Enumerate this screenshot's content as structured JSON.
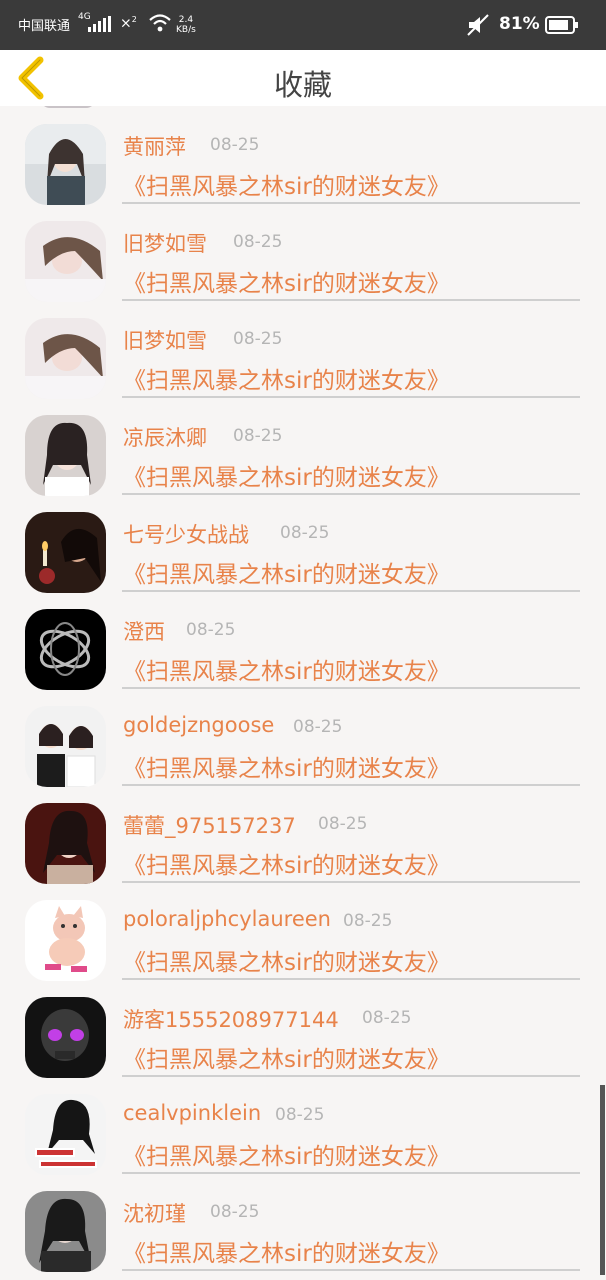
{
  "status_bar": {
    "carrier": "中国联通",
    "network": "4G",
    "sim2": "2",
    "speed_value": "2.4",
    "speed_unit": "KB/s",
    "battery": "81%"
  },
  "header": {
    "title": "收藏"
  },
  "favorites": [
    {
      "name": "黄丽萍",
      "date": "08-25",
      "book": "《扫黑风暴之林sir的财迷女友》"
    },
    {
      "name": "旧梦如雪",
      "date": "08-25",
      "book": "《扫黑风暴之林sir的财迷女友》"
    },
    {
      "name": "旧梦如雪",
      "date": "08-25",
      "book": "《扫黑风暴之林sir的财迷女友》"
    },
    {
      "name": "凉辰沐卿",
      "date": "08-25",
      "book": "《扫黑风暴之林sir的财迷女友》"
    },
    {
      "name": "七号少女战战",
      "date": "08-25",
      "book": "《扫黑风暴之林sir的财迷女友》"
    },
    {
      "name": "澄西",
      "date": "08-25",
      "book": "《扫黑风暴之林sir的财迷女友》"
    },
    {
      "name": "goldejzngoose",
      "date": "08-25",
      "book": "《扫黑风暴之林sir的财迷女友》"
    },
    {
      "name": "蕾蕾_975157237",
      "date": "08-25",
      "book": "《扫黑风暴之林sir的财迷女友》"
    },
    {
      "name": "poloraljphcylaureen",
      "date": "08-25",
      "book": "《扫黑风暴之林sir的财迷女友》"
    },
    {
      "name": "游客1555208977144",
      "date": "08-25",
      "book": "《扫黑风暴之林sir的财迷女友》"
    },
    {
      "name": "cealvpinklein",
      "date": "08-25",
      "book": "《扫黑风暴之林sir的财迷女友》"
    },
    {
      "name": "沈初瑾",
      "date": "08-25",
      "book": "《扫黑风暴之林sir的财迷女友》"
    }
  ],
  "colors": {
    "accent": "#e8834a",
    "date": "#b5b5b5",
    "back_icon": "#f2c200"
  }
}
